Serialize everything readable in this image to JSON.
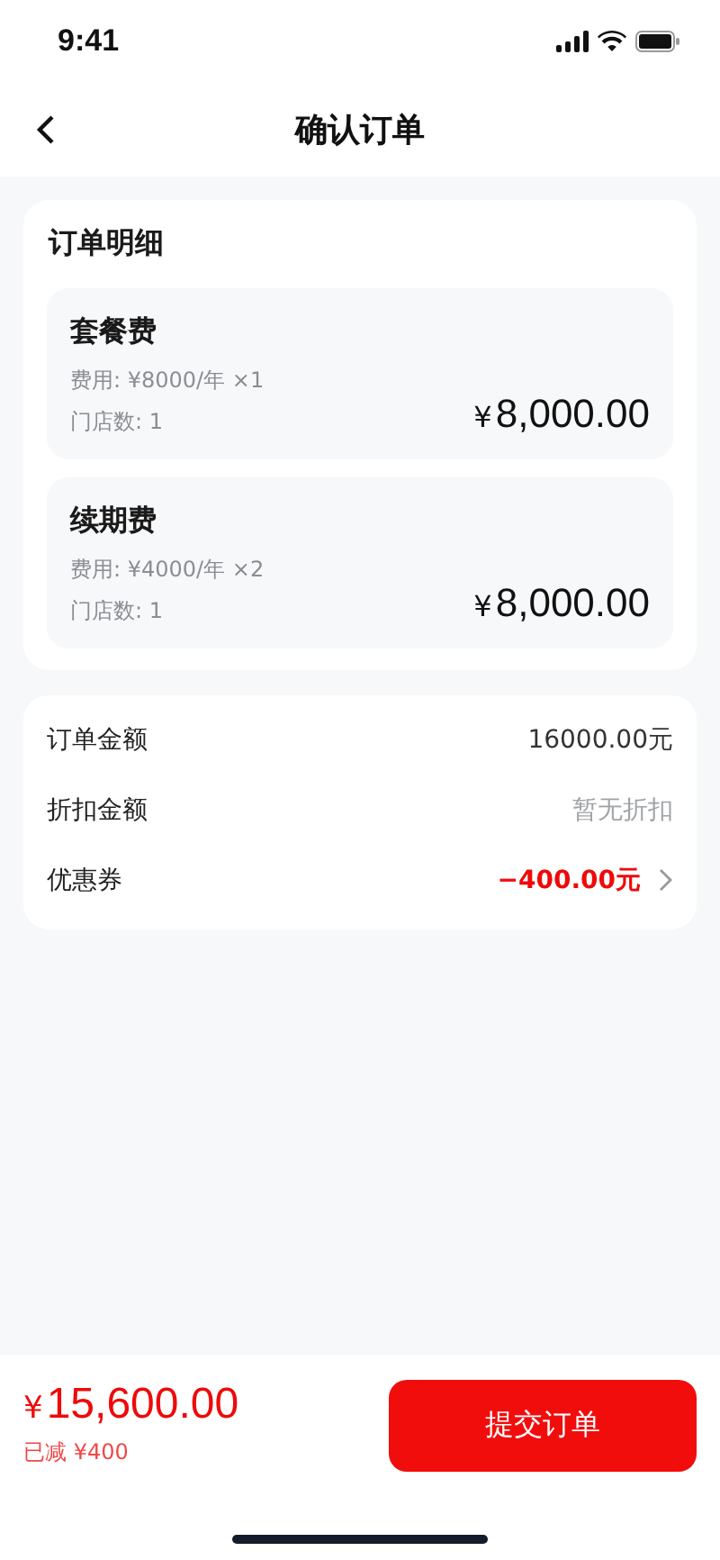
{
  "status_bar": {
    "time": "9:41"
  },
  "nav": {
    "title": "确认订单"
  },
  "details": {
    "title": "订单明细",
    "items": [
      {
        "name": "套餐费",
        "fee": "费用: ¥8000/年 ×1",
        "stores": "门店数: 1",
        "currency": "¥",
        "amount": "8,000.00"
      },
      {
        "name": "续期费",
        "fee": "费用: ¥4000/年 ×2",
        "stores": "门店数: 1",
        "currency": "¥",
        "amount": "8,000.00"
      }
    ]
  },
  "summary": [
    {
      "label": "订单金额",
      "value": "16000.00元",
      "kind": "normal"
    },
    {
      "label": "折扣金额",
      "value": "暂无折扣",
      "kind": "muted"
    },
    {
      "label": "优惠券",
      "value": "−400.00元",
      "kind": "discount"
    }
  ],
  "footer": {
    "currency": "¥",
    "total": "15,600.00",
    "saved": "已减 ¥400",
    "submit": "提交订单"
  }
}
